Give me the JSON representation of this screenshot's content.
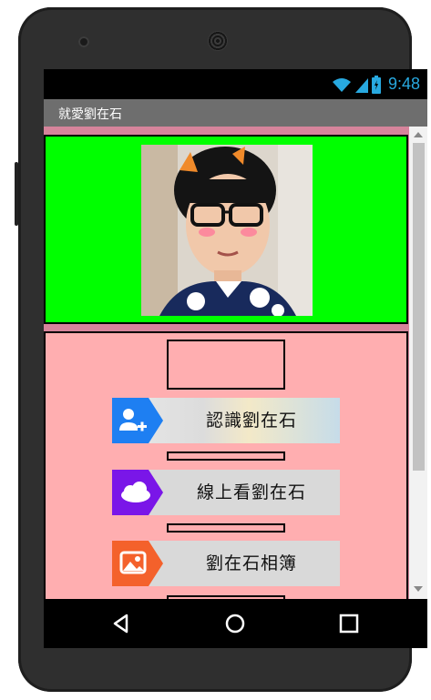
{
  "status": {
    "time": "9:48"
  },
  "app": {
    "title": "就愛劉在石"
  },
  "menu": [
    {
      "label": "認識劉在石",
      "icon": "add-user-icon",
      "color": "#1e7ff2"
    },
    {
      "label": "線上看劉在石",
      "icon": "cloud-icon",
      "color": "#7a16e8"
    },
    {
      "label": "劉在石相簿",
      "icon": "image-icon",
      "color": "#f4612b"
    }
  ],
  "colors": {
    "green_panel": "#00ff00",
    "pink_panel": "#ffaeb0",
    "title_bar": "#6e6e6e",
    "status_time": "#28a9e0"
  }
}
